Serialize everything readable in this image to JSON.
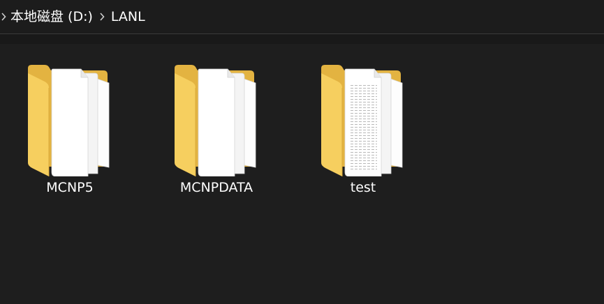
{
  "breadcrumb": {
    "items": [
      "本地磁盘 (D:)",
      "LANL"
    ]
  },
  "folders": [
    {
      "name": "MCNP5"
    },
    {
      "name": "MCNPDATA"
    },
    {
      "name": "test"
    }
  ],
  "colors": {
    "background": "#1e1e1e",
    "folder_front": "#f6cf5f",
    "folder_back": "#e3b341"
  },
  "icons": {
    "breadcrumb_separator": "chevron-right-icon",
    "folder": "folder-with-documents-icon"
  }
}
